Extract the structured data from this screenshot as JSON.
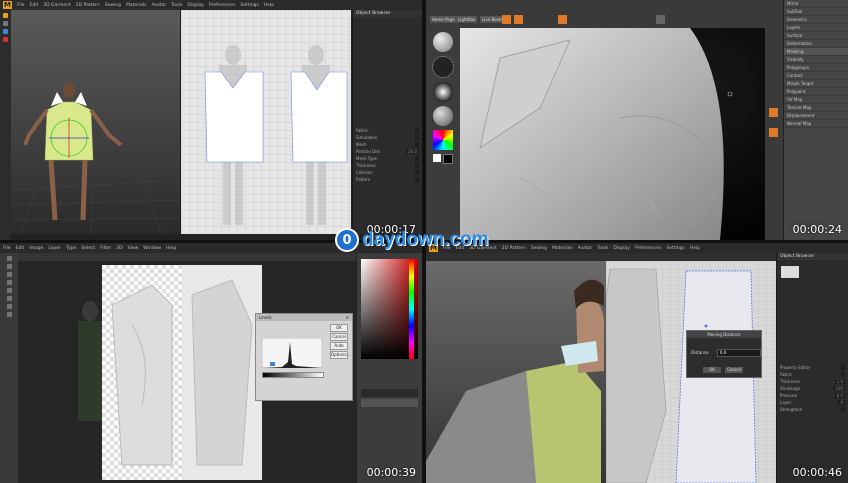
{
  "watermark": {
    "disc": "0",
    "text": "daydown.com"
  },
  "q1": {
    "logo": "M",
    "menu": [
      "File",
      "Edit",
      "3D Garment",
      "2D Pattern",
      "Sewing",
      "Materials",
      "Avatar",
      "Tools",
      "Display",
      "Preferences",
      "Settings",
      "Help"
    ],
    "panel_rows": [
      {
        "label": "Fabric",
        "value": ""
      },
      {
        "label": "Simulation",
        "value": ""
      },
      {
        "label": "Mesh",
        "value": ""
      },
      {
        "label": "Particle Dist",
        "value": "20.0"
      },
      {
        "label": "Mesh Type",
        "value": ""
      },
      {
        "label": "Thickness",
        "value": ""
      },
      {
        "label": "Collision",
        "value": ""
      },
      {
        "label": "Pattern",
        "value": ""
      }
    ],
    "timestamp": "00:00:17"
  },
  "q2": {
    "timestamp": "00:00:24",
    "tray_rows": [
      "Mirror",
      "SubTool",
      "Geometry",
      "Layers",
      "Surface",
      "Deformation",
      "Masking",
      "Visibility",
      "Polygroups",
      "Contact",
      "Morph Target",
      "Polypaint",
      "UV Map",
      "Texture Map",
      "Displacement",
      "Normal Map"
    ],
    "tray_highlight": 6
  },
  "q3": {
    "timestamp": "00:00:39",
    "menu": [
      "File",
      "Edit",
      "Image",
      "Layer",
      "Type",
      "Select",
      "Filter",
      "3D",
      "View",
      "Window",
      "Help"
    ],
    "levels_title": "Levels",
    "levels_ok": "OK",
    "levels_cancel": "Cancel",
    "levels_auto": "Auto",
    "levels_options": "Options..."
  },
  "q4": {
    "timestamp": "00:00:46",
    "logo": "M",
    "menu": [
      "File",
      "Edit",
      "3D Garment",
      "2D Pattern",
      "Sewing",
      "Materials",
      "Avatar",
      "Tools",
      "Display",
      "Preferences",
      "Settings",
      "Help"
    ],
    "dialog_title": "Moving Distance",
    "dialog_label": "Distance",
    "dialog_value": "0.0",
    "dialog_ok": "OK",
    "dialog_cancel": "Cancel",
    "panel_rows": [
      {
        "label": "Property Editor",
        "value": ""
      },
      {
        "label": "Fabric",
        "value": ""
      },
      {
        "label": "Thickness",
        "value": "1.0"
      },
      {
        "label": "Shrinkage",
        "value": "100"
      },
      {
        "label": "Pressure",
        "value": "0.0"
      },
      {
        "label": "Layer",
        "value": "0"
      },
      {
        "label": "Strengthen",
        "value": ""
      }
    ]
  }
}
